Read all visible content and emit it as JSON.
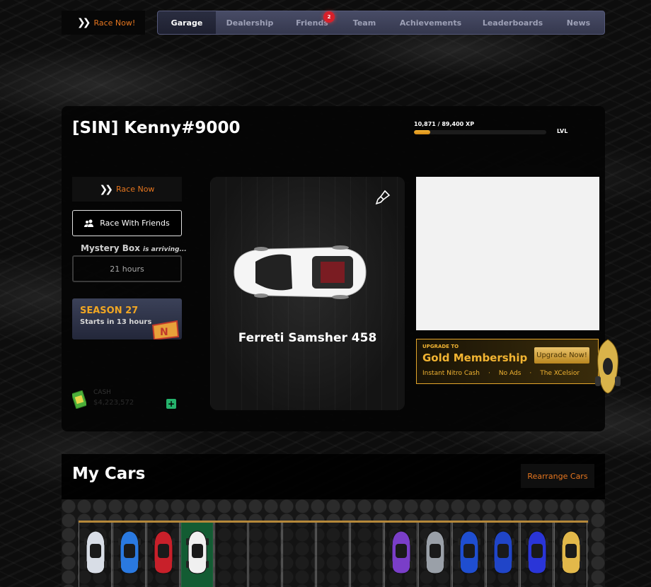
{
  "top": {
    "race_now": "Race Now!",
    "tabs": [
      {
        "label": "Garage",
        "active": true
      },
      {
        "label": "Dealership"
      },
      {
        "label": "Friends",
        "badge": "2"
      },
      {
        "label": "Team"
      },
      {
        "label": "Achievements"
      },
      {
        "label": "Leaderboards"
      },
      {
        "label": "News"
      }
    ]
  },
  "profile": {
    "name": "[SIN] Kenny#9000",
    "xp_text": "10,871 / 89,400 XP",
    "xp_progress": 0.1216,
    "lvl_label": "LVL",
    "race_now": "Race Now",
    "race_with_friends": "Race With Friends",
    "mystery_title": "Mystery Box",
    "mystery_sub": "is arriving...",
    "mystery_time": "21 hours",
    "season_title": "SEASON 27",
    "season_sub": "Starts in 13 hours",
    "cash_label": "CASH",
    "cash_value": "$4,223,572",
    "car_name": "Ferreti Samsher 458"
  },
  "gold": {
    "upgrade_to": "UPGRADE TO",
    "title": "Gold Membership",
    "perks": [
      "Instant Nitro Cash",
      "·",
      "No Ads",
      "·",
      "The XCelsior"
    ],
    "button": "Upgrade Now!"
  },
  "mycars": {
    "title": "My Cars",
    "rearrange": "Rearrange Cars",
    "slots": [
      {
        "car": "white-blue-car-icon",
        "color": "#d8dde6"
      },
      {
        "car": "blue-car-icon",
        "color": "#2a79e0"
      },
      {
        "car": "red-formula-car-icon",
        "color": "#c8202a"
      },
      {
        "car": "white-ferrari-car-icon",
        "color": "#f0f0f0",
        "selected": true
      },
      {
        "car": ""
      },
      {
        "car": ""
      },
      {
        "car": ""
      },
      {
        "car": ""
      },
      {
        "car": ""
      },
      {
        "car": "purple-kart-icon",
        "color": "#7a3ec8"
      },
      {
        "car": "silver-pod-car-icon",
        "color": "#9aa0a8"
      },
      {
        "car": "blue-buggy-icon",
        "color": "#1f4ed0"
      },
      {
        "car": "blue-sports-car-icon",
        "color": "#2045c8"
      },
      {
        "car": "blue-truck-icon",
        "color": "#2a35d8"
      },
      {
        "car": "gold-blue-car-icon",
        "color": "#e2b84a"
      }
    ]
  }
}
